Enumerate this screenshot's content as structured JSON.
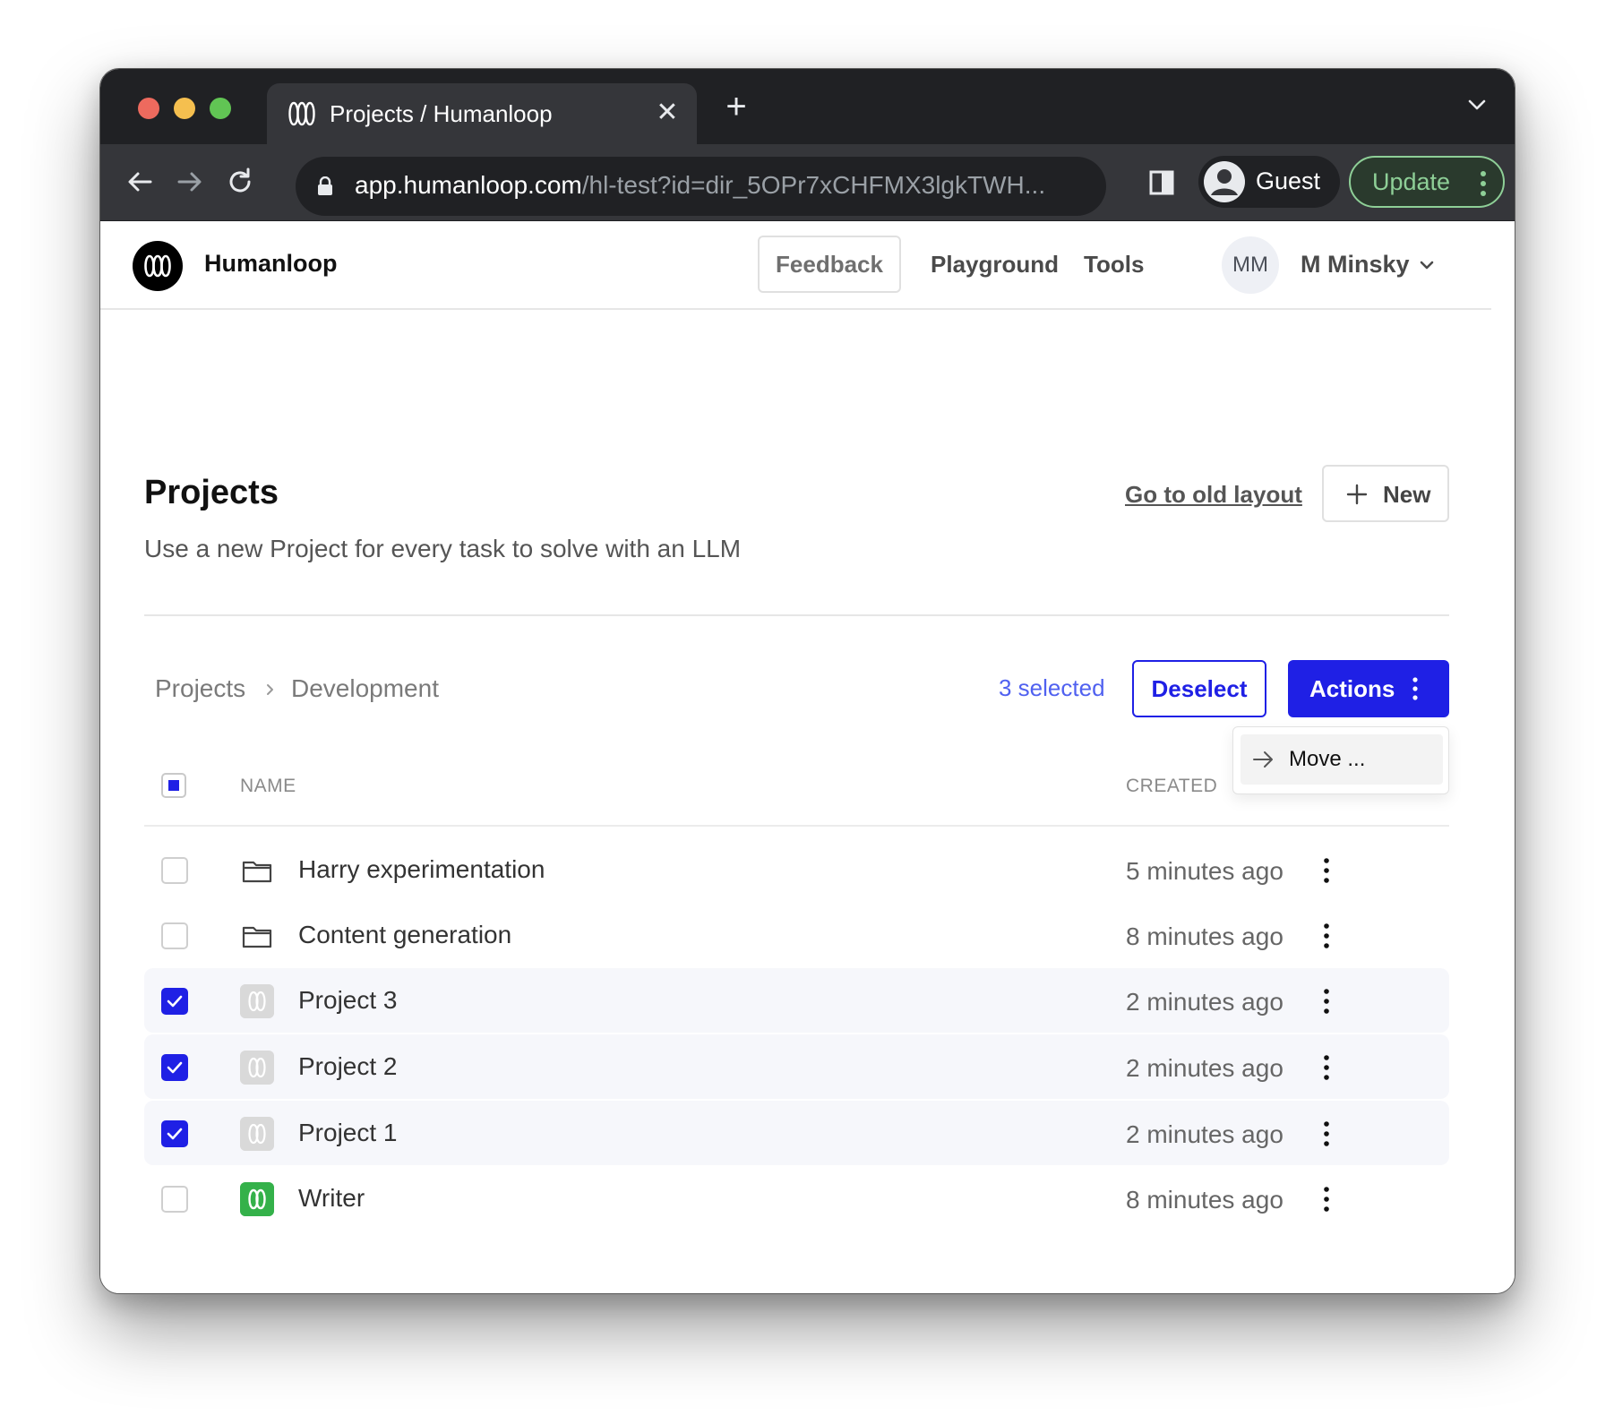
{
  "browser": {
    "tab_title": "Projects / Humanloop",
    "url_host": "app.humanloop.com",
    "url_path": "/hl-test?id=dir_5OPr7xCHFMX3lgkTWH...",
    "profile_label": "Guest",
    "update_label": "Update"
  },
  "header": {
    "brand": "Humanloop",
    "nav": {
      "feedback": "Feedback",
      "playground": "Playground",
      "tools": "Tools"
    },
    "user_initials": "MM",
    "user_name": "M Minsky"
  },
  "main": {
    "title": "Projects",
    "subtitle": "Use a new Project for every task to solve with an LLM",
    "old_layout_link": "Go to old layout",
    "new_button": "New",
    "breadcrumb": [
      "Projects",
      "Development"
    ],
    "selection_count": "3 selected",
    "deselect_button": "Deselect",
    "actions_button": "Actions",
    "actions_menu": [
      {
        "label": "Move ...",
        "icon": "arrow-right-icon"
      }
    ]
  },
  "table": {
    "columns": [
      "NAME",
      "CREATED"
    ],
    "rows": [
      {
        "name": "Harry experimentation",
        "created": "5 minutes ago",
        "type": "folder",
        "checked": false
      },
      {
        "name": "Content generation",
        "created": "8 minutes ago",
        "type": "folder",
        "checked": false
      },
      {
        "name": "Project 3",
        "created": "2 minutes ago",
        "type": "project",
        "checked": true
      },
      {
        "name": "Project 2",
        "created": "2 minutes ago",
        "type": "project",
        "checked": true
      },
      {
        "name": "Project 1",
        "created": "2 minutes ago",
        "type": "project",
        "checked": true
      },
      {
        "name": "Writer",
        "created": "8 minutes ago",
        "type": "project-green",
        "checked": false
      }
    ]
  },
  "colors": {
    "accent": "#1f20e5",
    "selected_text": "#5061f0",
    "selected_row_bg": "#f6f7fb",
    "update_green": "#8ecf97",
    "writer_icon": "#34b14a"
  }
}
